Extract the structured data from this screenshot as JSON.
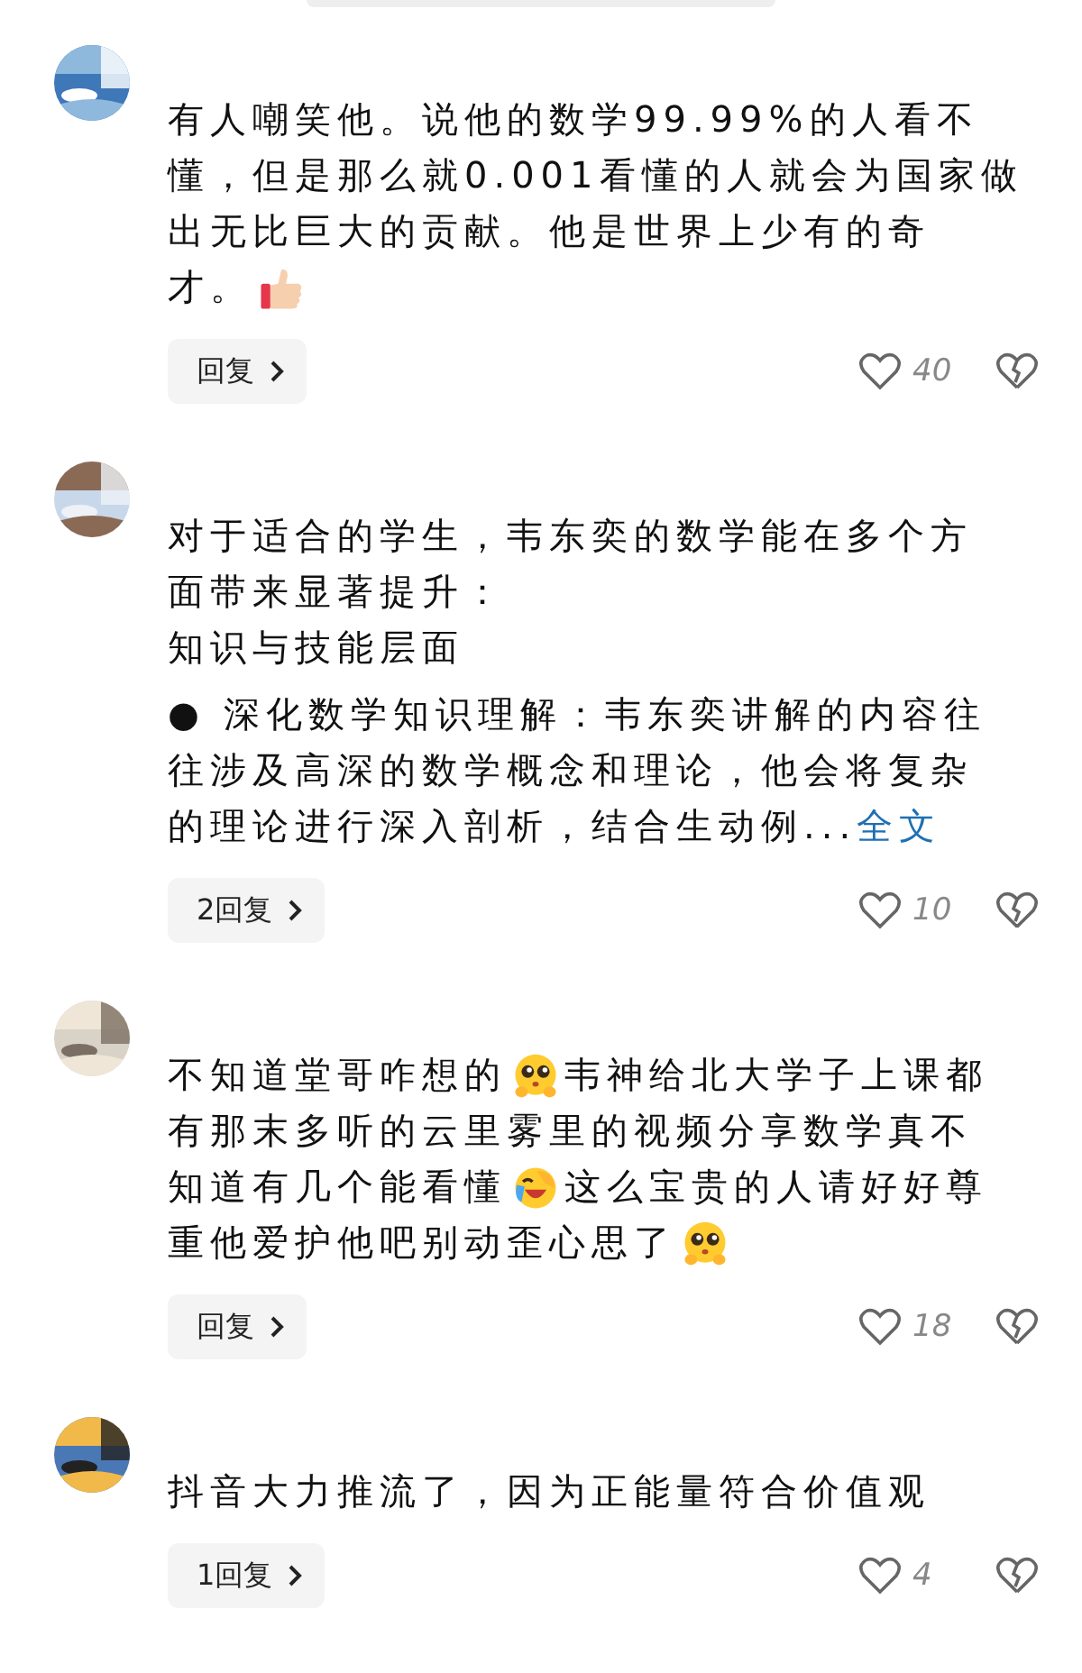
{
  "comments": [
    {
      "avatar": {
        "kind": "picture"
      },
      "lines": [
        [
          {
            "kind": "text",
            "text": "有人嘲笑他。说他的数学99.99%的人看不"
          }
        ],
        [
          {
            "kind": "text",
            "text": "懂，但是那么就0.001看懂的人就会为国家做"
          }
        ],
        [
          {
            "kind": "text",
            "text": "出无比巨大的贡献。他是世界上少有的奇"
          }
        ],
        [
          {
            "kind": "text",
            "text": "才。"
          },
          {
            "kind": "thumbs_up"
          }
        ]
      ],
      "reply_button": "回复",
      "likes": "40"
    },
    {
      "avatar": {
        "kind": "picture"
      },
      "lines": [
        [
          {
            "kind": "text",
            "text": "对于适合的学生，韦东奕的数学能在多个方"
          }
        ],
        [
          {
            "kind": "text",
            "text": "面带来显著提升："
          }
        ],
        [
          {
            "kind": "text",
            "text": "知识与技能层面"
          }
        ],
        [
          {
            "kind": "text",
            "text": "● 深化数学知识理解：韦东奕讲解的内容往"
          }
        ],
        [
          {
            "kind": "text",
            "text": "往涉及高深的数学概念和理论，他会将复杂"
          }
        ],
        [
          {
            "kind": "text",
            "text": "的理论进行深入剖析，结合生动例..."
          },
          {
            "kind": "link",
            "text": "全文"
          }
        ]
      ],
      "reply_button": "2回复",
      "likes": "10"
    },
    {
      "avatar": {
        "kind": "picture"
      },
      "lines": [
        [
          {
            "kind": "text",
            "text": "不知道堂哥咋想的"
          },
          {
            "kind": "pleading_face"
          },
          {
            "kind": "text",
            "text": "韦神给北大学子上课都"
          }
        ],
        [
          {
            "kind": "text",
            "text": "有那末多听的云里雾里的视频分享数学真不"
          }
        ],
        [
          {
            "kind": "text",
            "text": "知道有几个能看懂"
          },
          {
            "kind": "laughing_face"
          },
          {
            "kind": "text",
            "text": "这么宝贵的人请好好尊"
          }
        ],
        [
          {
            "kind": "text",
            "text": "重他爱护他吧别动歪心思了"
          },
          {
            "kind": "pleading_face"
          }
        ]
      ],
      "reply_button": "回复",
      "likes": "18"
    },
    {
      "avatar": {
        "kind": "picture"
      },
      "lines": [
        [
          {
            "kind": "text",
            "text": "抖音大力推流了，因为正能量符合价值观"
          }
        ]
      ],
      "reply_button": "1回复",
      "likes": "4"
    }
  ]
}
